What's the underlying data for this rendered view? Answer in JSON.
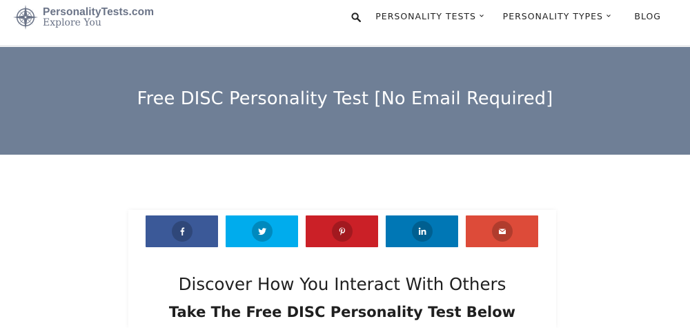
{
  "header": {
    "logo": {
      "icon": "compass-icon",
      "name": "PersonalityTests.com",
      "tagline": "Explore You"
    },
    "search_icon": "search-icon",
    "nav": [
      {
        "label": "PERSONALITY TESTS",
        "has_dropdown": true
      },
      {
        "label": "PERSONALITY TYPES",
        "has_dropdown": true
      },
      {
        "label": "BLOG",
        "has_dropdown": false
      }
    ]
  },
  "hero": {
    "title": "Free DISC Personality Test [No Email Required]",
    "background": "#6f7f96"
  },
  "share": {
    "buttons": [
      {
        "network": "facebook",
        "icon": "facebook-icon",
        "color": "#3b5998"
      },
      {
        "network": "twitter",
        "icon": "twitter-icon",
        "color": "#00aced"
      },
      {
        "network": "pinterest",
        "icon": "pinterest-icon",
        "color": "#cb2027"
      },
      {
        "network": "linkedin",
        "icon": "linkedin-icon",
        "color": "#0077b5"
      },
      {
        "network": "email",
        "icon": "email-icon",
        "color": "#dd4b39"
      }
    ]
  },
  "content": {
    "headline": "Discover How You Interact With Others",
    "subheadline": "Take The Free DISC Personality Test Below"
  }
}
